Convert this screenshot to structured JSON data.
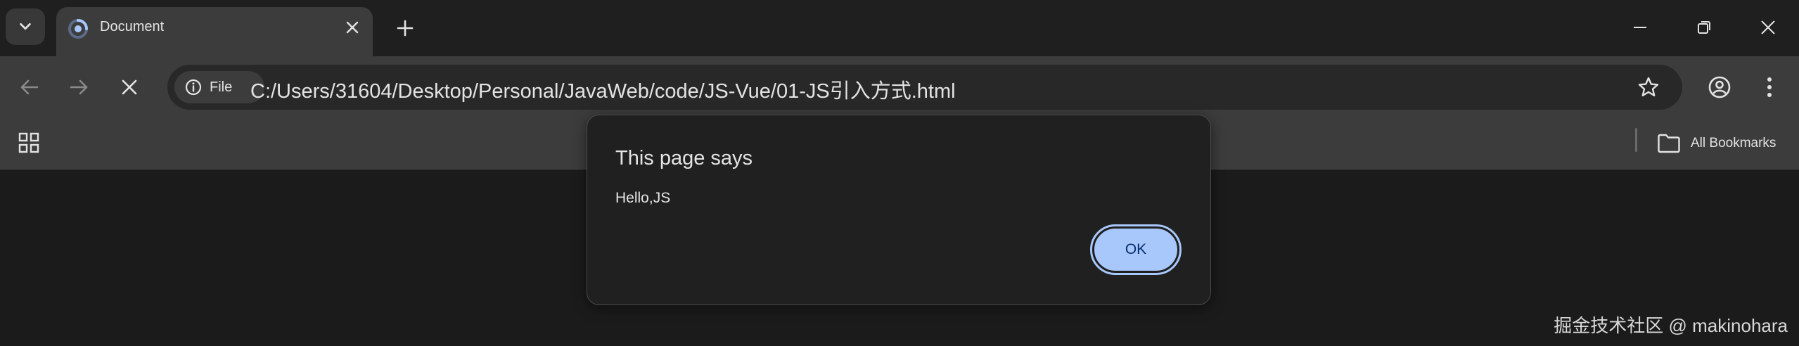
{
  "tab": {
    "title": "Document",
    "favicon": "loading-spinner-icon"
  },
  "toolbar": {
    "chip_label": "File",
    "url": "C:/Users/31604/Desktop/Personal/JavaWeb/code/JS-Vue/01-JS引入方式.html"
  },
  "bookmarks": {
    "all_bookmarks_label": "All Bookmarks"
  },
  "dialog": {
    "title": "This page says",
    "message": "Hello,JS",
    "ok_label": "OK"
  },
  "watermark": "掘金技术社区 @ makinohara",
  "colors": {
    "accent": "#a8c7fa",
    "toolbar": "#3c3c3c",
    "page_bg": "#1b1b1b"
  }
}
